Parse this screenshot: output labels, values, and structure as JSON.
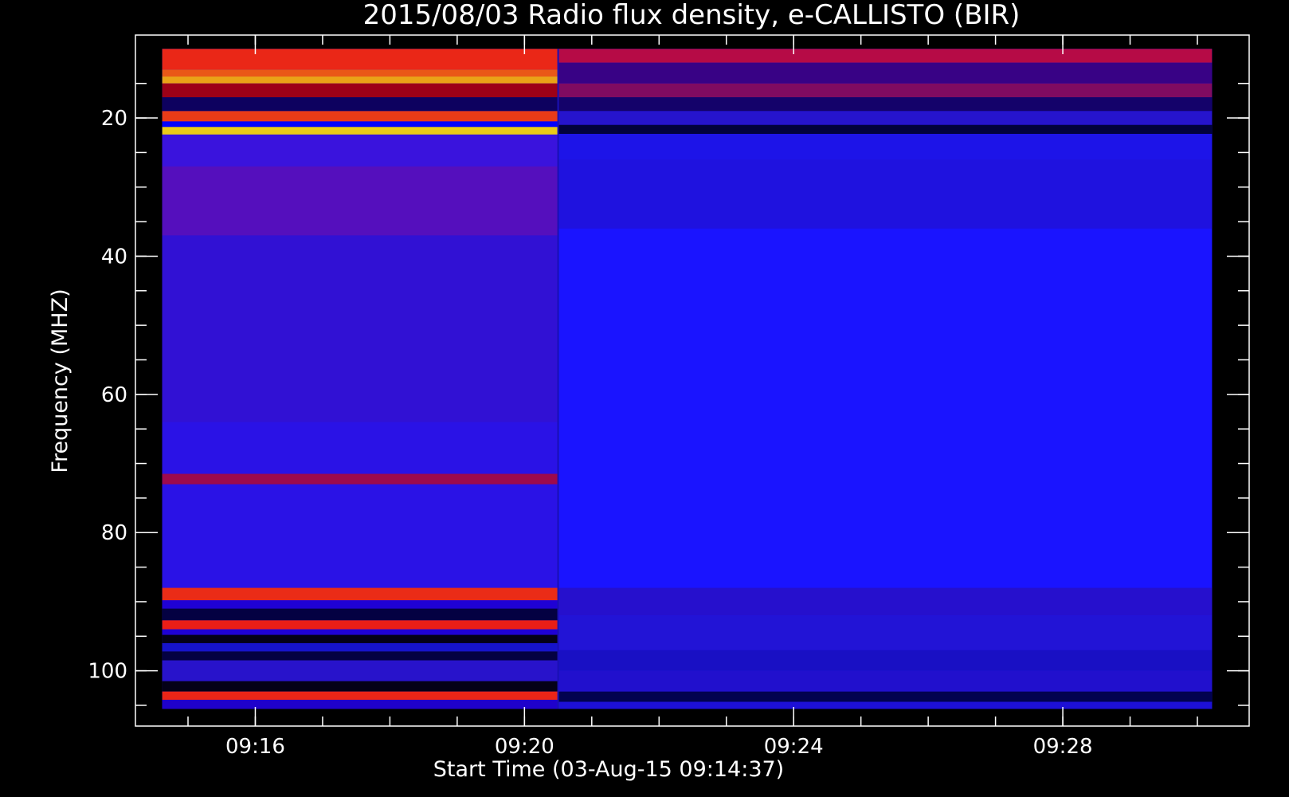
{
  "chart_data": {
    "type": "heatmap",
    "title": "2015/08/03  Radio flux density, e-CALLISTO (BIR)",
    "xlabel": "Start Time (03-Aug-15 09:14:37)",
    "ylabel": "Frequency (MHZ)",
    "x_range": [
      "09:14:37",
      "09:30:13"
    ],
    "y_range_mhz": [
      105.5,
      10
    ],
    "y_axis_frame_mhz": [
      108,
      8
    ],
    "x_major_ticks": [
      "09:16",
      "09:20",
      "09:24",
      "09:28"
    ],
    "x_minor_ticks": [
      "09:15",
      "09:16",
      "09:17",
      "09:18",
      "09:19",
      "09:20",
      "09:21",
      "09:22",
      "09:23",
      "09:24",
      "09:25",
      "09:26",
      "09:27",
      "09:28",
      "09:29",
      "09:30"
    ],
    "y_major_ticks": [
      20,
      40,
      60,
      80,
      100
    ],
    "y_minor_ticks": [
      15,
      20,
      25,
      30,
      35,
      40,
      45,
      50,
      55,
      60,
      65,
      70,
      75,
      80,
      85,
      90,
      95,
      100,
      105
    ],
    "segment_break": "09:20:30",
    "colormap": [
      "#000000",
      "#0000ff",
      "#ff0000",
      "#ffff00",
      "#ffffff"
    ],
    "background_color": "#1a14ff",
    "segments": [
      {
        "x_start": "09:14:37",
        "x_end": "09:20:30",
        "base_color": "#2a12e6",
        "bands": [
          {
            "f_from": 10,
            "f_to": 13,
            "color": "#ff2a00"
          },
          {
            "f_from": 13,
            "f_to": 14,
            "color": "#ff6000"
          },
          {
            "f_from": 14,
            "f_to": 15,
            "color": "#ffb400"
          },
          {
            "f_from": 15,
            "f_to": 17,
            "color": "#aa0000"
          },
          {
            "f_from": 17,
            "f_to": 19,
            "color": "#0a0050"
          },
          {
            "f_from": 19,
            "f_to": 20.5,
            "color": "#ff4000"
          },
          {
            "f_from": 20.5,
            "f_to": 21.3,
            "color": "#0000ff"
          },
          {
            "f_from": 21.3,
            "f_to": 22.4,
            "color": "#ffe000"
          },
          {
            "f_from": 22.4,
            "f_to": 27,
            "color": "#3c14dc"
          },
          {
            "f_from": 27,
            "f_to": 37,
            "color": "#5a10b8"
          },
          {
            "f_from": 37,
            "f_to": 64,
            "color": "#3212d2"
          },
          {
            "f_from": 71.5,
            "f_to": 73,
            "color": "#aa0a3c"
          },
          {
            "f_from": 88,
            "f_to": 89.8,
            "color": "#ff3000"
          },
          {
            "f_from": 89.8,
            "f_to": 91,
            "color": "#1e00d2"
          },
          {
            "f_from": 91,
            "f_to": 92.7,
            "color": "#000030"
          },
          {
            "f_from": 92.7,
            "f_to": 94,
            "color": "#ff2000"
          },
          {
            "f_from": 94,
            "f_to": 94.8,
            "color": "#1e00d2"
          },
          {
            "f_from": 94.8,
            "f_to": 96,
            "color": "#000000"
          },
          {
            "f_from": 96,
            "f_to": 97.2,
            "color": "#1414c8"
          },
          {
            "f_from": 97.2,
            "f_to": 98.5,
            "color": "#000030"
          },
          {
            "f_from": 98.5,
            "f_to": 101.5,
            "color": "#2814c8"
          },
          {
            "f_from": 101.5,
            "f_to": 103,
            "color": "#000000"
          },
          {
            "f_from": 103,
            "f_to": 104.2,
            "color": "#ff2800"
          },
          {
            "f_from": 104.2,
            "f_to": 105.5,
            "color": "#1e00c8"
          }
        ]
      },
      {
        "x_start": "09:20:30",
        "x_end": "09:30:13",
        "base_color": "#1a14ff",
        "bands": [
          {
            "f_from": 10,
            "f_to": 12,
            "color": "#c80a32"
          },
          {
            "f_from": 12,
            "f_to": 15,
            "color": "#3c0078"
          },
          {
            "f_from": 15,
            "f_to": 17,
            "color": "#8c0a50"
          },
          {
            "f_from": 17,
            "f_to": 19,
            "color": "#14005a"
          },
          {
            "f_from": 19,
            "f_to": 21,
            "color": "#2814c8"
          },
          {
            "f_from": 21,
            "f_to": 22.3,
            "color": "#000028"
          },
          {
            "f_from": 22.3,
            "f_to": 26,
            "color": "#1e14e6"
          },
          {
            "f_from": 26,
            "f_to": 36,
            "color": "#2012dc"
          },
          {
            "f_from": 88,
            "f_to": 92,
            "color": "#2810c8"
          },
          {
            "f_from": 92,
            "f_to": 97,
            "color": "#2414d2"
          },
          {
            "f_from": 97,
            "f_to": 100,
            "color": "#1a10be"
          },
          {
            "f_from": 100,
            "f_to": 103,
            "color": "#2210c8"
          },
          {
            "f_from": 103,
            "f_to": 104.5,
            "color": "#00003c"
          },
          {
            "f_from": 104.5,
            "f_to": 105.5,
            "color": "#1e10d2"
          }
        ]
      }
    ],
    "grid": false,
    "legend": "none"
  }
}
